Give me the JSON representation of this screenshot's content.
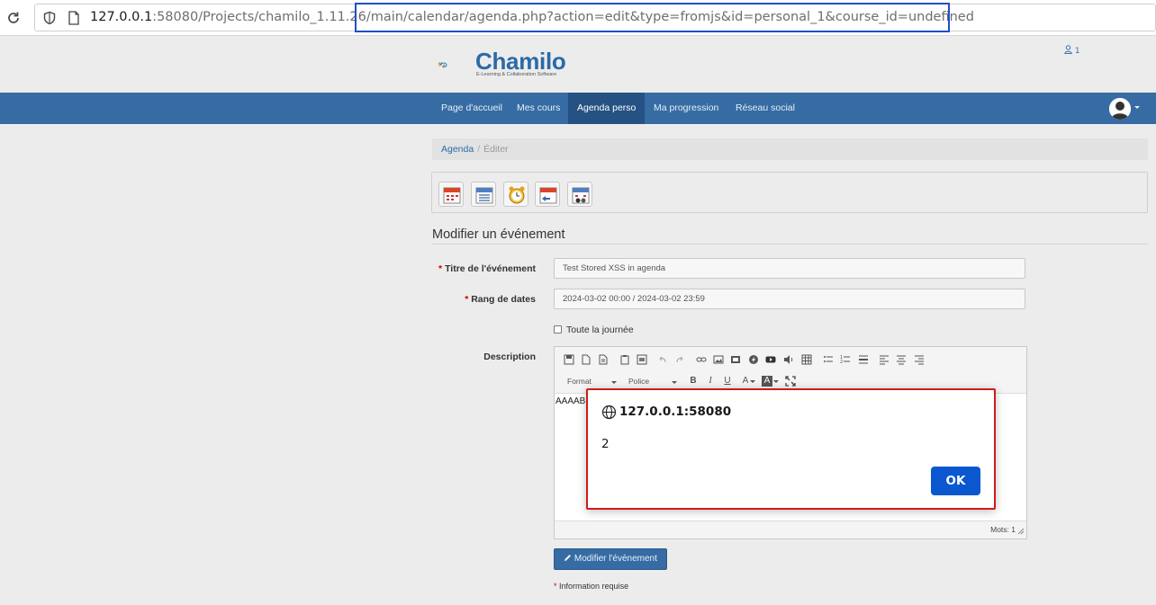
{
  "browser": {
    "url_host": "127.0.0.1",
    "url_rest_before": ":58080/Projects/chamilo_1.11.26",
    "url_highlighted": "/main/calendar/agenda.php?action=edit&type=fromjs&id=personal_1&course_id=undefined",
    "highlight_color": "#1f4ec9"
  },
  "header": {
    "logo_text": "Chamilo",
    "logo_subtitle": "E-Learning & Collaboration Software",
    "notification_count": "1"
  },
  "nav": {
    "items": [
      {
        "label": "Page d'accueil",
        "active": false
      },
      {
        "label": "Mes cours",
        "active": false
      },
      {
        "label": "Agenda perso",
        "active": true
      },
      {
        "label": "Ma progression",
        "active": false
      },
      {
        "label": "Réseau social",
        "active": false
      }
    ],
    "bar_color": "#366ca3",
    "active_color": "#255283"
  },
  "breadcrumb": {
    "items": [
      "Agenda",
      "Éditer"
    ],
    "separator": "/"
  },
  "toolbar": {
    "icons": [
      "calendar-add-icon",
      "calendar-list-icon",
      "alarm-clock-icon",
      "calendar-import-icon",
      "calendar-sessions-icon"
    ]
  },
  "form": {
    "title": "Modifier un événement",
    "required_mark": "*",
    "fields": {
      "title_label": "Titre de l'événement",
      "title_value": "Test Stored XSS in agenda",
      "date_label": "Rang de dates",
      "date_value": "2024-03-02 00:00 / 2024-03-02 23:59",
      "all_day_label": "Toute la journée",
      "description_label": "Description"
    },
    "editor": {
      "format_label": "Format",
      "font_label": "Police",
      "content": "AAAABB",
      "word_count": "Mots: 1"
    },
    "submit_label": "Modifier l'évènement",
    "required_note": "Information requise"
  },
  "dialog": {
    "origin": "127.0.0.1:58080",
    "message": "2",
    "ok_label": "OK",
    "border_color": "#d31a1a",
    "button_color": "#0b57d0"
  }
}
